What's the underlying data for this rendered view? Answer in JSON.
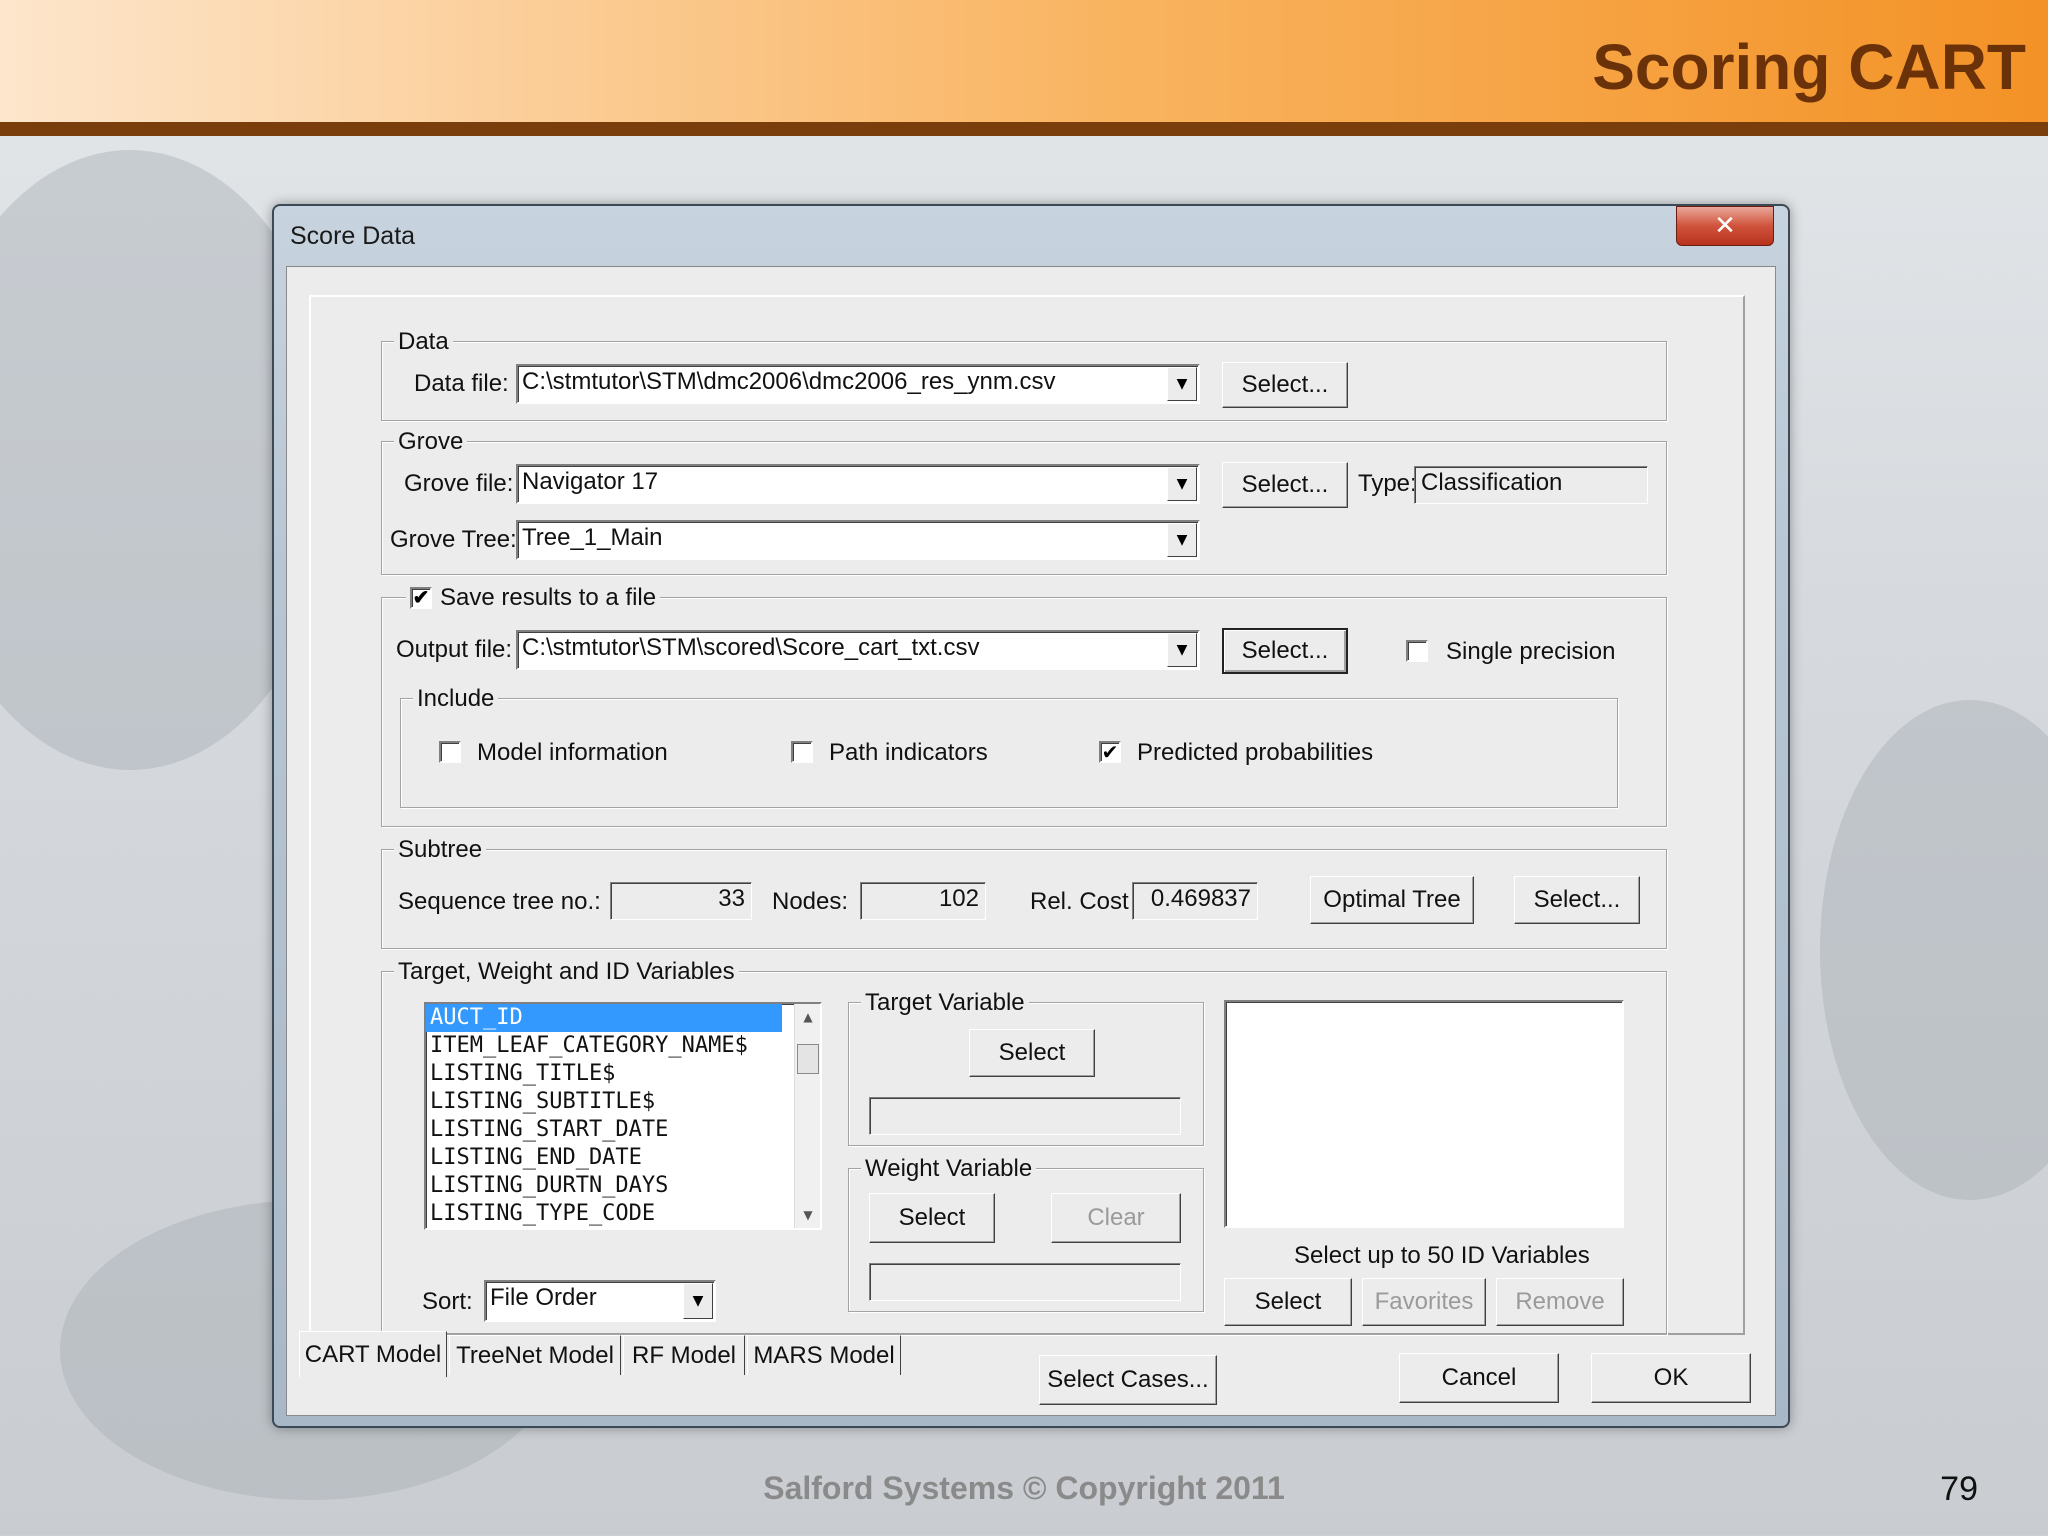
{
  "slide": {
    "title": "Scoring CART",
    "footer": "Salford Systems   © Copyright 2011",
    "page_number": "79"
  },
  "window": {
    "title": "Score Data",
    "close_glyph": "✕"
  },
  "data_group": {
    "legend": "Data",
    "file_label": "Data file:",
    "file_value": "C:\\stmtutor\\STM\\dmc2006\\dmc2006_res_ynm.csv",
    "select_label": "Select..."
  },
  "grove_group": {
    "legend": "Grove",
    "file_label": "Grove file:",
    "file_value": "Navigator 17",
    "select_label": "Select...",
    "type_label": "Type:",
    "type_value": "Classification",
    "tree_label": "Grove Tree:",
    "tree_value": "Tree_1_Main"
  },
  "save_group": {
    "legend": "Save results to a file",
    "save_checked": true,
    "output_label": "Output file:",
    "output_value": "C:\\stmtutor\\STM\\scored\\Score_cart_txt.csv",
    "select_label": "Select...",
    "single_precision_label": "Single precision",
    "single_precision_checked": false,
    "include": {
      "legend": "Include",
      "model_info_label": "Model information",
      "model_info_checked": false,
      "path_indicators_label": "Path indicators",
      "path_indicators_checked": false,
      "predicted_prob_label": "Predicted probabilities",
      "predicted_prob_checked": true
    }
  },
  "subtree_group": {
    "legend": "Subtree",
    "seq_label": "Sequence tree no.:",
    "seq_value": "33",
    "nodes_label": "Nodes:",
    "nodes_value": "102",
    "relcost_label": "Rel. Cost",
    "relcost_value": "0.469837",
    "optimal_label": "Optimal Tree",
    "select_label": "Select..."
  },
  "variables_group": {
    "legend": "Target, Weight and ID Variables",
    "list_items": [
      "AUCT_ID",
      "ITEM_LEAF_CATEGORY_NAME$",
      "LISTING_TITLE$",
      "LISTING_SUBTITLE$",
      "LISTING_START_DATE",
      "LISTING_END_DATE",
      "LISTING_DURTN_DAYS",
      "LISTING_TYPE_CODE"
    ],
    "sort_label": "Sort:",
    "sort_value": "File Order",
    "target": {
      "legend": "Target Variable",
      "select_label": "Select",
      "value": ""
    },
    "weight": {
      "legend": "Weight Variable",
      "select_label": "Select",
      "clear_label": "Clear",
      "value": ""
    },
    "id": {
      "caption": "Select up to 50 ID Variables",
      "select_label": "Select",
      "favorites_label": "Favorites",
      "remove_label": "Remove"
    }
  },
  "tabs": [
    "CART Model",
    "TreeNet Model",
    "RF Model",
    "MARS Model"
  ],
  "bottom": {
    "select_cases_label": "Select Cases...",
    "cancel_label": "Cancel",
    "ok_label": "OK"
  },
  "icons": {
    "dropdown": "▼",
    "scroll_up": "▲",
    "scroll_down": "▼",
    "check": "✔"
  }
}
